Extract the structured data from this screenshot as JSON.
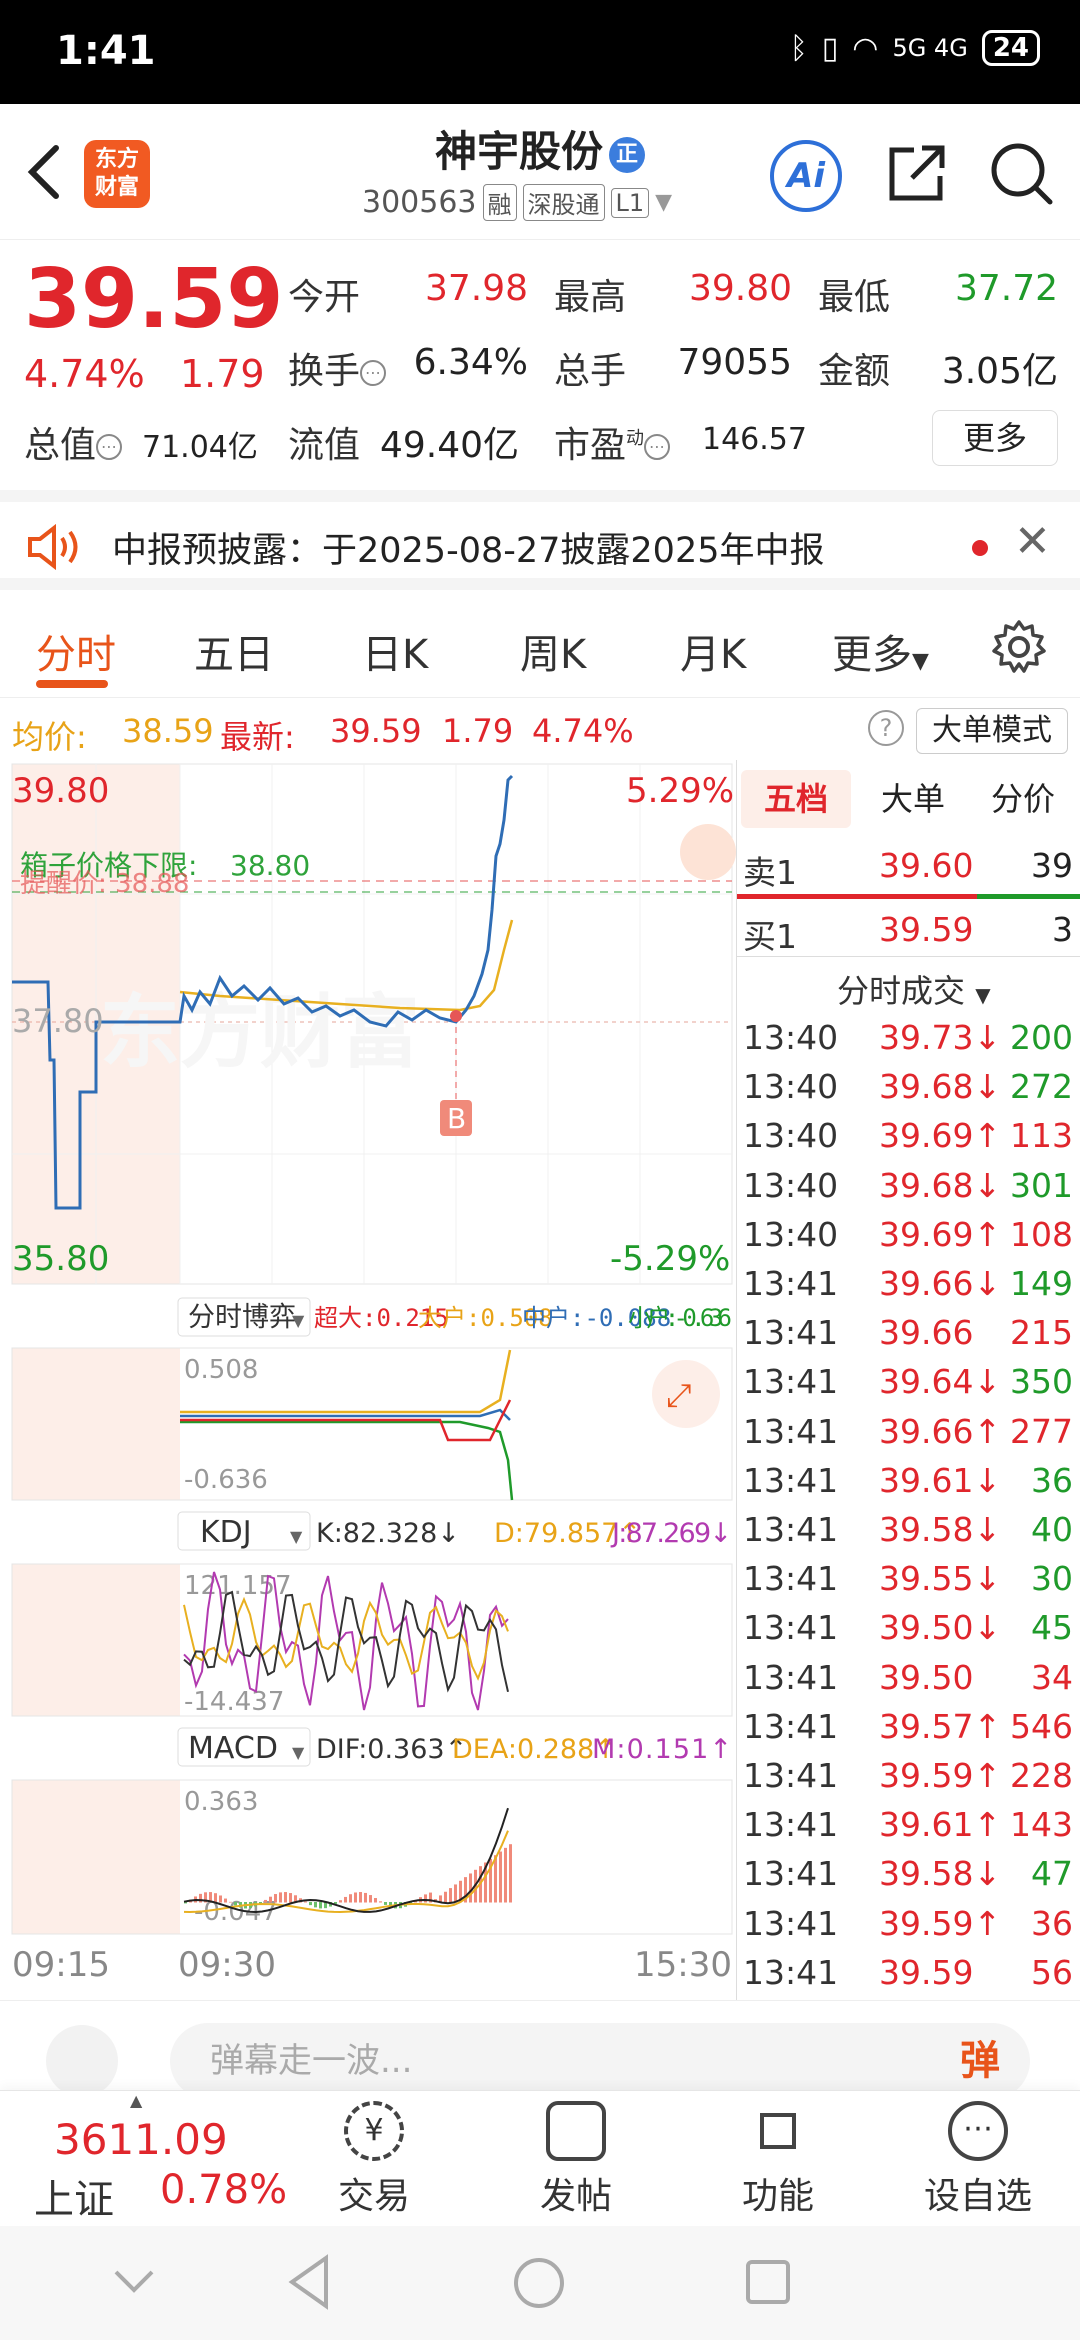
{
  "status_bar": {
    "time": "1:41",
    "signal": "5G 4G",
    "battery": "24"
  },
  "header": {
    "stock_name": "神宇股份",
    "badge": "正",
    "code": "300563",
    "tags": [
      "融",
      "深股通",
      "L1"
    ],
    "logo_line1": "东方",
    "logo_line2": "财富",
    "ai_label": "Ai"
  },
  "quote": {
    "price": "39.59",
    "change_pct": "4.74%",
    "change_amt": "1.79",
    "open_label": "今开",
    "open": "37.98",
    "high_label": "最高",
    "high": "39.80",
    "low_label": "最低",
    "low": "37.72",
    "turnover_label": "换手",
    "turnover": "6.34%",
    "volume_label": "总手",
    "volume": "79055",
    "amount_label": "金额",
    "amount": "3.05亿",
    "mktcap_label": "总值",
    "mktcap": "71.04亿",
    "float_label": "流值",
    "float": "49.40亿",
    "pe_label": "市盈",
    "pe_sup": "动",
    "pe": "146.57",
    "more_label": "更多"
  },
  "notice": {
    "text": "中报预披露：于2025-08-27披露2025年中报"
  },
  "tabs": [
    "分时",
    "五日",
    "日K",
    "周K",
    "月K",
    "更多"
  ],
  "avg_line": {
    "avg_label": "均价:",
    "avg": "38.59",
    "last_label": "最新:",
    "last": "39.59",
    "chg": "1.79",
    "pct": "4.74%",
    "mode_btn": "大单模式"
  },
  "chart": {
    "y_top": "39.80",
    "y_bottom": "35.80",
    "pct_top": "5.29%",
    "pct_bottom": "-5.29%",
    "y_mid": "37.80",
    "limit_label": "箱子价格下限:",
    "limit_value": "38.80",
    "alert_label": "提醒价: 38.88",
    "b_marker": "B",
    "watermark": "东方财富",
    "game_label": "分时博弈",
    "game_super": "超大:0.215",
    "game_big": "大户:0.508",
    "game_mid": "中户:-0.088",
    "game_small": "小户:-0.636",
    "game_top": "0.508",
    "game_bottom": "-0.636",
    "kdj_label": "KDJ",
    "kdj_k": "K:82.328↓",
    "kdj_d": "D:79.857↑",
    "kdj_j": "J:87.269↓",
    "kdj_top": "121.157",
    "kdj_bottom": "-14.437",
    "macd_label": "MACD",
    "macd_dif": "DIF:0.363↑",
    "macd_dea": "DEA:0.288↑",
    "macd_m": "M:0.151↑",
    "macd_top": "0.363",
    "macd_bottom": "-0.047",
    "x_start": "09:15",
    "x_mid": "09:30",
    "x_end": "15:30"
  },
  "orderbook": {
    "tabs": [
      "五档",
      "大单",
      "分价"
    ],
    "sell1_label": "卖1",
    "sell1_price": "39.60",
    "sell1_vol": "39",
    "buy1_label": "买1",
    "buy1_price": "39.59",
    "buy1_vol": "3",
    "trades_header": "分时成交",
    "trades": [
      {
        "time": "13:40",
        "price": "39.73↓",
        "vol": "200",
        "dir": "down"
      },
      {
        "time": "13:40",
        "price": "39.68↓",
        "vol": "272",
        "dir": "down"
      },
      {
        "time": "13:40",
        "price": "39.69↑",
        "vol": "113",
        "dir": "up"
      },
      {
        "time": "13:40",
        "price": "39.68↓",
        "vol": "301",
        "dir": "down"
      },
      {
        "time": "13:40",
        "price": "39.69↑",
        "vol": "108",
        "dir": "up"
      },
      {
        "time": "13:41",
        "price": "39.66↓",
        "vol": "149",
        "dir": "down"
      },
      {
        "time": "13:41",
        "price": "39.66",
        "vol": "215",
        "dir": "flat"
      },
      {
        "time": "13:41",
        "price": "39.64↓",
        "vol": "350",
        "dir": "down"
      },
      {
        "time": "13:41",
        "price": "39.66↑",
        "vol": "277",
        "dir": "up"
      },
      {
        "time": "13:41",
        "price": "39.61↓",
        "vol": "36",
        "dir": "down"
      },
      {
        "time": "13:41",
        "price": "39.58↓",
        "vol": "40",
        "dir": "down"
      },
      {
        "time": "13:41",
        "price": "39.55↓",
        "vol": "30",
        "dir": "down"
      },
      {
        "time": "13:41",
        "price": "39.50↓",
        "vol": "45",
        "dir": "down"
      },
      {
        "time": "13:41",
        "price": "39.50",
        "vol": "34",
        "dir": "flat"
      },
      {
        "time": "13:41",
        "price": "39.57↑",
        "vol": "546",
        "dir": "up"
      },
      {
        "time": "13:41",
        "price": "39.59↑",
        "vol": "228",
        "dir": "up"
      },
      {
        "time": "13:41",
        "price": "39.61↑",
        "vol": "143",
        "dir": "up"
      },
      {
        "time": "13:41",
        "price": "39.58↓",
        "vol": "47",
        "dir": "down"
      },
      {
        "time": "13:41",
        "price": "39.59↑",
        "vol": "36",
        "dir": "up"
      },
      {
        "time": "13:41",
        "price": "39.59",
        "vol": "56",
        "dir": "flat"
      }
    ]
  },
  "danmu": {
    "placeholder": "弹幕走一波...",
    "send_icon": "弹"
  },
  "bottom_nav": {
    "index_value": "3611.09",
    "index_name": "上证",
    "index_pct": "0.78%",
    "items": [
      "交易",
      "发帖",
      "功能",
      "设自选"
    ]
  },
  "colors": {
    "up": "#e0262c",
    "down": "#1f9a2a",
    "accent": "#e8541a",
    "line": "#2f6db5",
    "avg": "#e8b020"
  }
}
